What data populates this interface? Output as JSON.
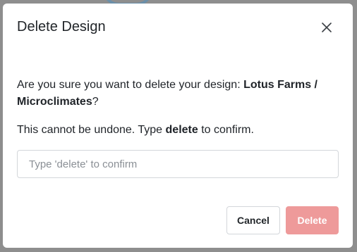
{
  "dialog": {
    "title": "Delete Design",
    "question_prefix": "Are you sure you want to delete your design: ",
    "design_name": "Lotus Farms / Microclimates",
    "question_suffix": "?",
    "warning_prefix": "This cannot be undone. Type ",
    "keyword": "delete",
    "warning_suffix": " to confirm.",
    "input": {
      "value": "",
      "placeholder": "Type 'delete' to confirm"
    },
    "buttons": {
      "cancel_label": "Cancel",
      "delete_label": "Delete"
    },
    "close_icon": "close-icon"
  },
  "colors": {
    "delete_button_disabled": "#ee9a9a",
    "backdrop": "#8e8e8e"
  }
}
